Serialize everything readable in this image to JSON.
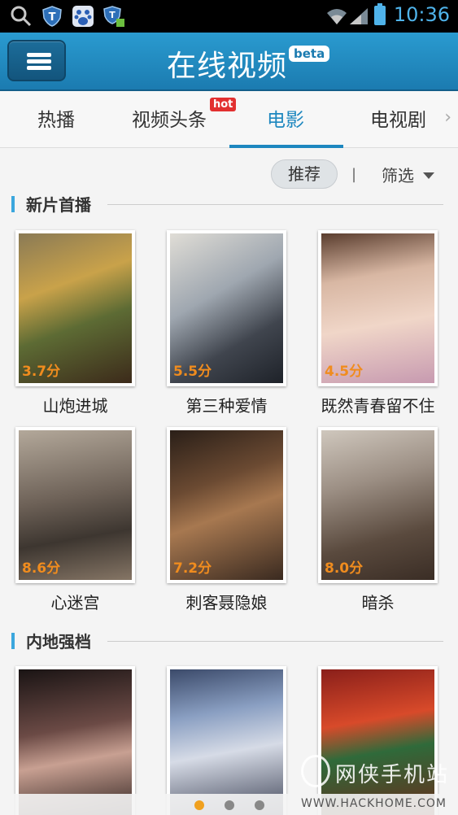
{
  "status_bar": {
    "time": "10:36",
    "icons": [
      "search-icon",
      "shield-icon",
      "baidu-icon",
      "shield-app-icon",
      "wifi-icon",
      "signal-icon",
      "battery-icon"
    ]
  },
  "header": {
    "title": "在线视频",
    "badge": "beta",
    "menu_icon": "hamburger-menu-icon"
  },
  "tabs": [
    {
      "label": "热播",
      "active": false
    },
    {
      "label": "视频头条",
      "active": false,
      "badge": "hot"
    },
    {
      "label": "电影",
      "active": true
    },
    {
      "label": "电视剧",
      "active": false
    }
  ],
  "filter_bar": {
    "recommend_label": "推荐",
    "separator": "|",
    "filter_label": "筛选"
  },
  "sections": [
    {
      "title": "新片首播",
      "movies": [
        {
          "title": "山炮进城",
          "score": "3.7",
          "unit": "分"
        },
        {
          "title": "第三种爱情",
          "score": "5.5",
          "unit": "分"
        },
        {
          "title": "既然青春留不住",
          "score": "4.5",
          "unit": "分"
        },
        {
          "title": "心迷宫",
          "score": "8.6",
          "unit": "分"
        },
        {
          "title": "刺客聂隐娘",
          "score": "7.2",
          "unit": "分"
        },
        {
          "title": "暗杀",
          "score": "8.0",
          "unit": "分"
        }
      ]
    },
    {
      "title": "内地强档",
      "movies": [
        {
          "title": "",
          "score": "",
          "unit": ""
        },
        {
          "title": "",
          "score": "",
          "unit": ""
        },
        {
          "title": "",
          "score": "",
          "unit": ""
        }
      ]
    }
  ],
  "watermark": {
    "text": "网侠手机站",
    "url": "WWW.HACKHOME.COM"
  },
  "pager": {
    "count": 3,
    "active_index": 0
  },
  "colors": {
    "accent": "#1d87bf",
    "header": "#1b7bb0",
    "score": "#f08c1e",
    "hot_badge": "#e23030"
  }
}
